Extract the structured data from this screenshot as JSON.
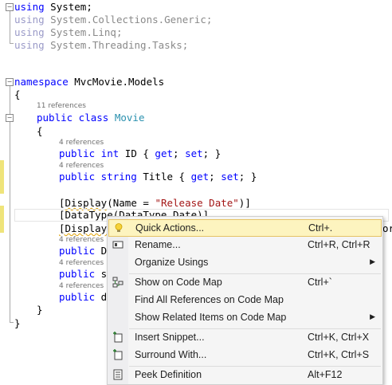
{
  "editor": {
    "usings": [
      {
        "kw": "using",
        "ns": "System;"
      },
      {
        "kw": "using",
        "ns": "System.Collections.Generic;"
      },
      {
        "kw": "using",
        "ns": "System.Linq;"
      },
      {
        "kw": "using",
        "ns": "System.Threading.Tasks;"
      }
    ],
    "namespace_kw": "namespace",
    "namespace_name": "MvcMovie.Models",
    "brace_open": "{",
    "brace_close": "}",
    "class_refs": "11 references",
    "class_kw": "public class",
    "class_name": "Movie",
    "refs4": "4 references",
    "id_line": {
      "kw": "public int",
      "rest": " ID { ",
      "get": "get",
      "semi1": "; ",
      "set": "set",
      "tail": "; }"
    },
    "title_line": {
      "kw": "public string",
      "rest": " Title { ",
      "get": "get",
      "semi1": "; ",
      "set": "set",
      "tail": "; }"
    },
    "attr1": {
      "pre": "[",
      "word": "Display",
      "mid": "(",
      "name": "Name",
      "eq": " = ",
      "str": "\"Release Date\"",
      "end": ")]"
    },
    "attr2": "[DataType(DataType.Date)]",
    "attr3_pre": "[Display",
    "attr3_tail": "or",
    "hidden_lines": [
      {
        "kw": "public",
        "rest": " Da"
      },
      {
        "kw": "public",
        "rest": " st"
      },
      {
        "kw": "public",
        "rest": " de"
      }
    ]
  },
  "context_menu": {
    "items": [
      {
        "label": "Quick Actions...",
        "shortcut": "Ctrl+.",
        "icon": "lightbulb-icon",
        "highlighted": true
      },
      {
        "label": "Rename...",
        "shortcut": "Ctrl+R, Ctrl+R",
        "icon": "rename-icon"
      },
      {
        "label": "Organize Usings",
        "shortcut": "",
        "icon": "",
        "submenu": true
      },
      {
        "label": "Show on Code Map",
        "shortcut": "Ctrl+`",
        "icon": "code-map-icon"
      },
      {
        "label": "Find All References on Code Map",
        "shortcut": "",
        "icon": ""
      },
      {
        "label": "Show Related Items on Code Map",
        "shortcut": "",
        "icon": "",
        "submenu": true
      },
      {
        "label": "Insert Snippet...",
        "shortcut": "Ctrl+K, Ctrl+X",
        "icon": "insert-snippet-icon"
      },
      {
        "label": "Surround With...",
        "shortcut": "Ctrl+K, Ctrl+S",
        "icon": "surround-with-icon"
      },
      {
        "label": "Peek Definition",
        "shortcut": "Alt+F12",
        "icon": "peek-definition-icon"
      }
    ],
    "submenu_arrow": "▶"
  },
  "colors": {
    "keyword": "#0000ff",
    "type": "#2b91af",
    "string": "#a31515",
    "highlight": "#fdf4bf"
  }
}
